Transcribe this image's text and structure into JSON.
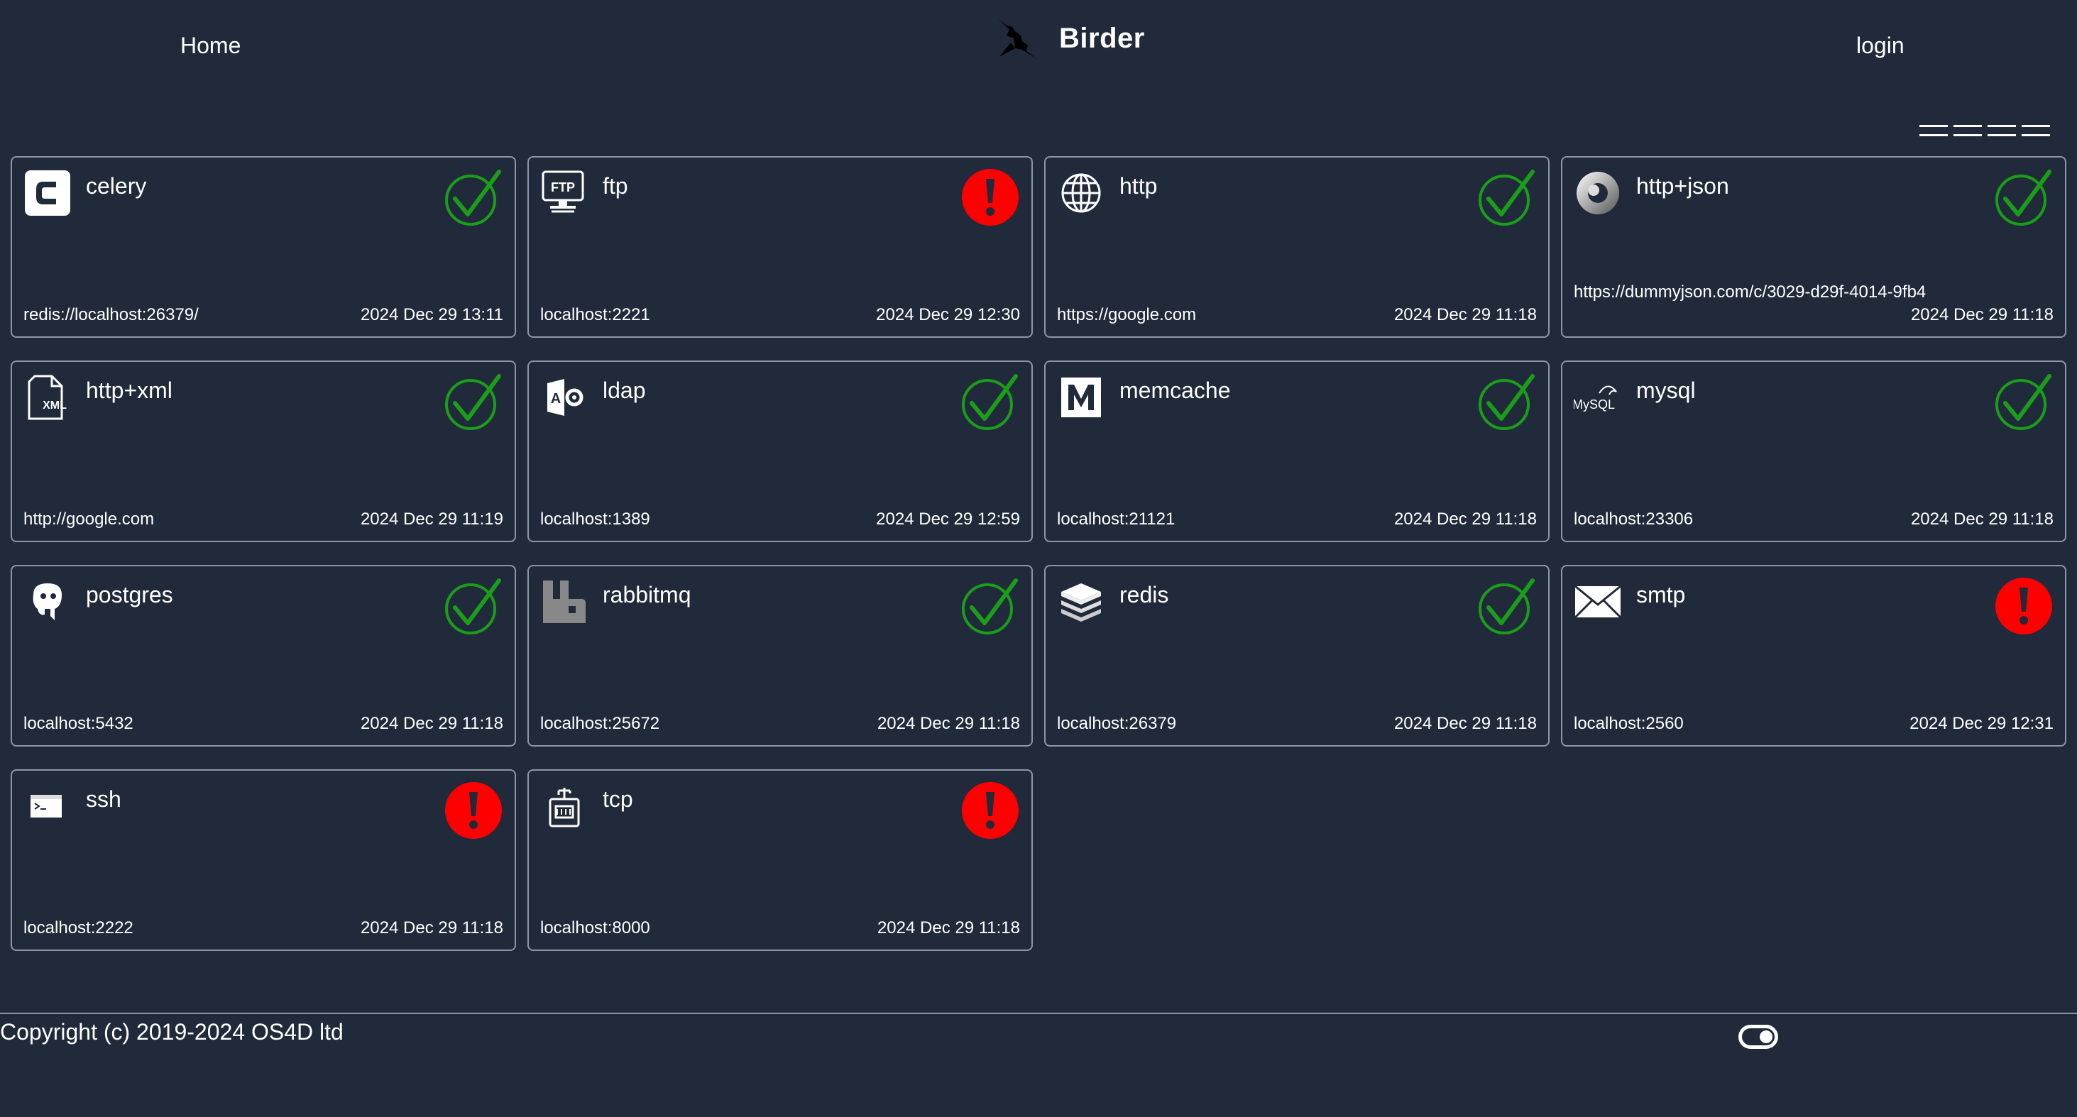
{
  "header": {
    "home_label": "Home",
    "brand_name": "Birder",
    "brand_logo_icon": "bird-icon",
    "login_label": "login",
    "layout_toggle_icon": "columns-layout-icon"
  },
  "status_colors": {
    "ok": "#1a9e1a",
    "error": "#ff0000"
  },
  "services": [
    {
      "name": "celery",
      "icon": "celery-icon",
      "target": "redis://localhost:26379/",
      "time": "2024 Dec 29 13:11",
      "status": "ok"
    },
    {
      "name": "ftp",
      "icon": "ftp-icon",
      "target": "localhost:2221",
      "time": "2024 Dec 29 12:30",
      "status": "error"
    },
    {
      "name": "http",
      "icon": "globe-icon",
      "target": "https://google.com",
      "time": "2024 Dec 29 11:18",
      "status": "ok"
    },
    {
      "name": "http+json",
      "icon": "json-icon",
      "target": "https://dummyjson.com/c/3029-d29f-4014-9fb4",
      "time": "2024 Dec 29 11:18",
      "status": "ok"
    },
    {
      "name": "http+xml",
      "icon": "xml-file-icon",
      "target": "http://google.com",
      "time": "2024 Dec 29 11:19",
      "status": "ok"
    },
    {
      "name": "ldap",
      "icon": "ldap-icon",
      "target": "localhost:1389",
      "time": "2024 Dec 29 12:59",
      "status": "ok"
    },
    {
      "name": "memcache",
      "icon": "memcache-icon",
      "target": "localhost:21121",
      "time": "2024 Dec 29 11:18",
      "status": "ok"
    },
    {
      "name": "mysql",
      "icon": "mysql-icon",
      "target": "localhost:23306",
      "time": "2024 Dec 29 11:18",
      "status": "ok"
    },
    {
      "name": "postgres",
      "icon": "postgres-icon",
      "target": "localhost:5432",
      "time": "2024 Dec 29 11:18",
      "status": "ok"
    },
    {
      "name": "rabbitmq",
      "icon": "rabbitmq-icon",
      "target": "localhost:25672",
      "time": "2024 Dec 29 11:18",
      "status": "ok"
    },
    {
      "name": "redis",
      "icon": "redis-icon",
      "target": "localhost:26379",
      "time": "2024 Dec 29 11:18",
      "status": "ok"
    },
    {
      "name": "smtp",
      "icon": "envelope-icon",
      "target": "localhost:2560",
      "time": "2024 Dec 29 12:31",
      "status": "error"
    },
    {
      "name": "ssh",
      "icon": "terminal-icon",
      "target": "localhost:2222",
      "time": "2024 Dec 29 11:18",
      "status": "error"
    },
    {
      "name": "tcp",
      "icon": "network-port-icon",
      "target": "localhost:8000",
      "time": "2024 Dec 29 11:18",
      "status": "error"
    }
  ],
  "footer": {
    "copyright": "Copyright (c) 2019-2024 OS4D ltd",
    "theme_toggle_icon": "toggle-switch-icon"
  }
}
